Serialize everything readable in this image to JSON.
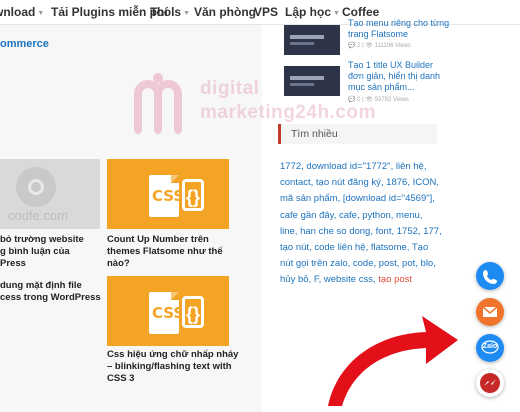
{
  "nav": {
    "items": [
      {
        "label": "Download",
        "chevron": true
      },
      {
        "label": "Tải Plugins miễn phí",
        "chevron": false
      },
      {
        "label": "Tools",
        "chevron": true
      },
      {
        "label": "Văn phòng",
        "chevron": false
      },
      {
        "label": "VPS",
        "chevron": false
      },
      {
        "label": "Lập học",
        "chevron": true
      },
      {
        "label": "Coffee",
        "chevron": false
      }
    ]
  },
  "left": {
    "section_title": "ommerce",
    "watermark_line1": "digital",
    "watermark_line2": "marketing24h.com",
    "grey_thumb_text": "codfe.com",
    "posts": [
      {
        "title": "bỏ trường website\ng bình luận của\nPress"
      },
      {
        "title": "Count Up Number trên\nthemes Flatsome như thế\nnào?"
      },
      {
        "title": "dung mặt định file\ncess trong WordPress"
      },
      {
        "title": "Css hiệu ứng chữ nhấp nháy\n– blinking/flashing text with\nCSS 3"
      }
    ],
    "css_icon_text": "CSS",
    "css_brace_text": "{}"
  },
  "sidebar": {
    "top_posts": [
      {
        "title": "Tạo menu riêng cho từng\ntrang Flatsome",
        "meta": "💬 2 | 👁 111106 Views"
      },
      {
        "title": "Tạo 1 title UX Builder\nđơn giản, hiển thị danh\nmục sản phẩm...",
        "meta": "💬 0 | 👁 93782 Views"
      }
    ],
    "section_heading": "Tìm nhiều",
    "tags": [
      {
        "text": "1772",
        "red": false
      },
      {
        "text": "download id=\"1772\"",
        "red": false
      },
      {
        "text": "liên hệ",
        "red": false
      },
      {
        "text": "contact",
        "red": false
      },
      {
        "text": "tạo nút đăng ký",
        "red": false
      },
      {
        "text": "1876",
        "red": false
      },
      {
        "text": "ICON",
        "red": false
      },
      {
        "text": "mã sản phẩm",
        "red": false
      },
      {
        "text": "[download id=\"4569\"]",
        "red": false
      },
      {
        "text": "cafe gần đây",
        "red": false
      },
      {
        "text": "cafe",
        "red": false
      },
      {
        "text": "python",
        "red": false
      },
      {
        "text": "menu",
        "red": false
      },
      {
        "text": "line",
        "red": false
      },
      {
        "text": "han che so dong",
        "red": false
      },
      {
        "text": "font",
        "red": false
      },
      {
        "text": "1752",
        "red": false
      },
      {
        "text": "177",
        "red": false
      },
      {
        "text": "tạo nút",
        "red": false
      },
      {
        "text": "code liên hệ",
        "red": false
      },
      {
        "text": "flatsome",
        "red": false
      },
      {
        "text": "Tạo nút gọi trên zalo",
        "red": false
      },
      {
        "text": "code",
        "red": false
      },
      {
        "text": "post",
        "red": false
      },
      {
        "text": "pot",
        "red": false
      },
      {
        "text": "blo",
        "red": false
      },
      {
        "text": "hủy bỏ",
        "red": false
      },
      {
        "text": "F",
        "red": false
      },
      {
        "text": "website css",
        "red": false
      },
      {
        "text": "tạo post",
        "red": true
      }
    ]
  },
  "fabs": {
    "zalo_label": "Zalo"
  },
  "colors": {
    "link": "#1e73be",
    "accent_red": "#e14b3b",
    "css_orange": "#f4a425",
    "arrow_red": "#e3101a"
  }
}
